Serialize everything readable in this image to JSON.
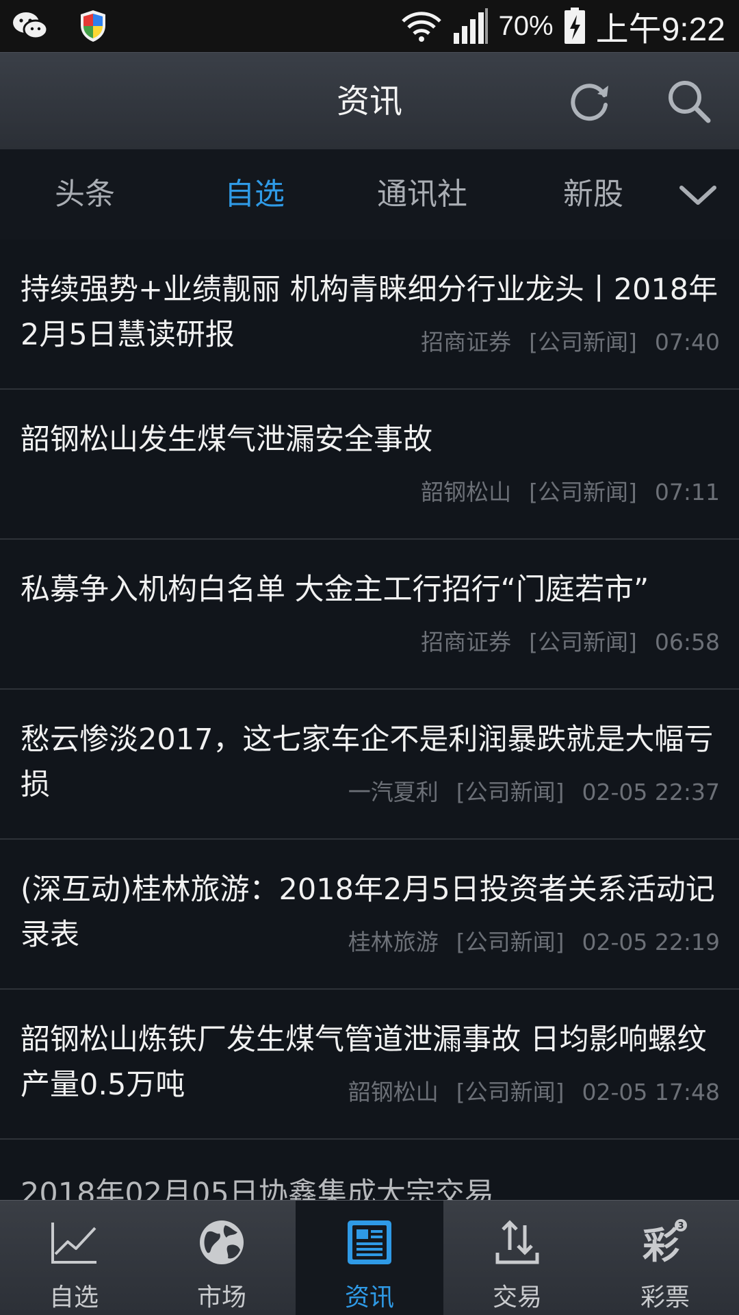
{
  "status_bar": {
    "battery": "70%",
    "time": "上午9:22",
    "icons": [
      "wechat-icon",
      "shield-icon",
      "wifi-icon",
      "signal-icon",
      "battery-charging-icon"
    ]
  },
  "header": {
    "title": "资讯",
    "refresh_icon": "refresh-icon",
    "search_icon": "search-icon"
  },
  "tabs": [
    {
      "label": "头条"
    },
    {
      "label": "自选",
      "active": true
    },
    {
      "label": "通讯社"
    },
    {
      "label": "新股"
    }
  ],
  "tabs_more_icon": "chevron-down-icon",
  "news": [
    {
      "title": "持续强势+业绩靓丽 机构青睐细分行业龙头丨2018年2月5日慧读研报",
      "source": "招商证券",
      "category": "[公司新闻]",
      "time": "07:40"
    },
    {
      "title": "韶钢松山发生煤气泄漏安全事故",
      "source": "韶钢松山",
      "category": "[公司新闻]",
      "time": "07:11"
    },
    {
      "title": "私募争入机构白名单 大金主工行招行“门庭若市”",
      "source": "招商证券",
      "category": "[公司新闻]",
      "time": "06:58"
    },
    {
      "title": "愁云惨淡2017，这七家车企不是利润暴跌就是大幅亏损",
      "source": "一汽夏利",
      "category": "[公司新闻]",
      "time": "02-05 22:37"
    },
    {
      "title": "(深互动)桂林旅游：2018年2月5日投资者关系活动记录表",
      "source": "桂林旅游",
      "category": "[公司新闻]",
      "time": "02-05 22:19"
    },
    {
      "title": "韶钢松山炼铁厂发生煤气管道泄漏事故 日均影响螺纹产量0.5万吨",
      "source": "韶钢松山",
      "category": "[公司新闻]",
      "time": "02-05 17:48"
    }
  ],
  "partial_news_title": "2018年02月05日协鑫集成大宗交易",
  "bottom_nav": [
    {
      "label": "自选",
      "icon": "line-chart-icon"
    },
    {
      "label": "市场",
      "icon": "globe-icon"
    },
    {
      "label": "资讯",
      "icon": "news-icon",
      "active": true
    },
    {
      "label": "交易",
      "icon": "trade-arrows-icon"
    },
    {
      "label": "彩票",
      "icon": "lottery-icon",
      "badge": "3"
    }
  ],
  "colors": {
    "accent": "#2f9ae6",
    "background": "#11151b"
  }
}
